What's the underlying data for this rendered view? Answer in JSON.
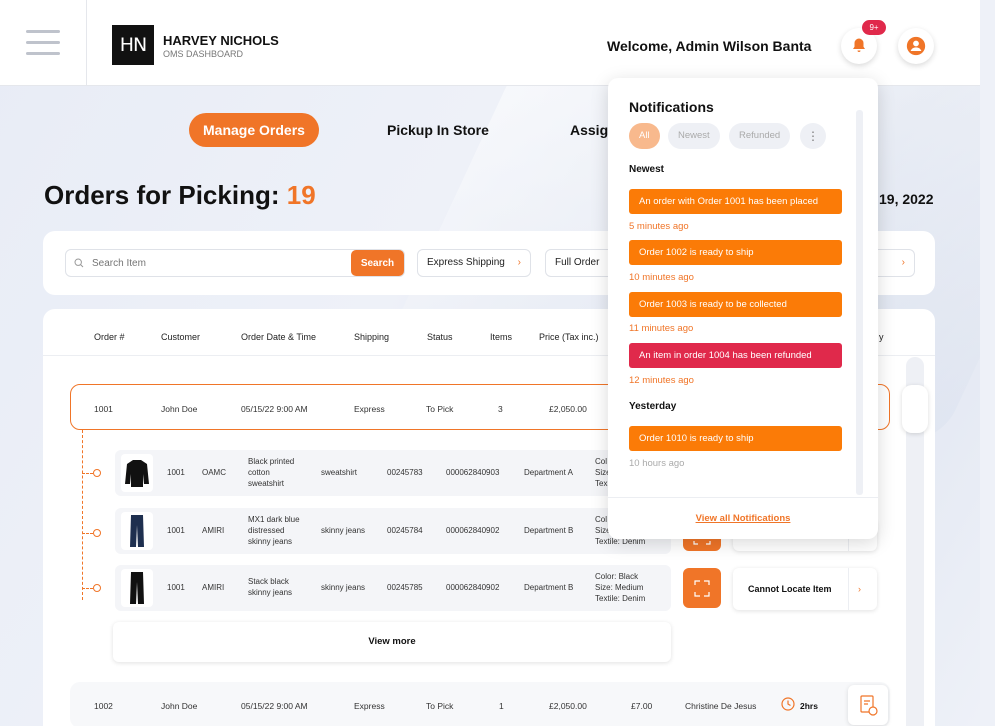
{
  "header": {
    "brand": "HARVEY NICHOLS",
    "brand_sub": "OMS DASHBOARD",
    "logo_text": "HN",
    "welcome": "Welcome, Admin Wilson Banta",
    "notif_badge": "9+"
  },
  "tabs": [
    {
      "label": "Manage Orders",
      "active": true
    },
    {
      "label": "Pickup In Store"
    },
    {
      "label": "Assig"
    }
  ],
  "page": {
    "title": "Orders for Picking: ",
    "count": "19",
    "date_fragment": "19, 2022"
  },
  "filters": {
    "search_placeholder": "Search Item",
    "search_button": "Search",
    "shipping": "Express Shipping",
    "status": "Full Order"
  },
  "table": {
    "columns": [
      "Order #",
      "Customer",
      "Order Date & Time",
      "Shipping",
      "Status",
      "Items",
      "Price (Tax inc.)",
      "y"
    ],
    "orders": [
      {
        "id": "1001",
        "customer": "John Doe",
        "date": "05/15/22  9:00 AM",
        "shipping": "Express",
        "status": "To Pick",
        "items": "3",
        "price": "£2,050.00"
      },
      {
        "id": "1002",
        "customer": "John Doe",
        "date": "05/15/22  9:00 AM",
        "shipping": "Express",
        "status": "To Pick",
        "items": "1",
        "price": "£2,050.00",
        "shipping_fee": "£7.00",
        "assignee": "Christine De Jesus",
        "time_left": "2hrs"
      }
    ],
    "items": [
      {
        "order": "1001",
        "brand": "OAMC",
        "name": [
          "Black printed",
          "cotton",
          "sweatshirt"
        ],
        "type": "sweatshirt",
        "sku": "00245783",
        "barcode": "000062840903",
        "department": "Department A",
        "attrs": [
          "Col",
          "Size",
          "Tex"
        ]
      },
      {
        "order": "1001",
        "brand": "AMIRI",
        "name": [
          "MX1 dark blue",
          "distressed",
          "skinny jeans"
        ],
        "type": "skinny jeans",
        "sku": "00245784",
        "barcode": "000062840902",
        "department": "Department B",
        "attrs": [
          "Col",
          "Size",
          "Textile: Denim"
        ]
      },
      {
        "order": "1001",
        "brand": "AMIRI",
        "name": [
          "Stack black",
          "skinny jeans"
        ],
        "type": "skinny jeans",
        "sku": "00245785",
        "barcode": "000062840902",
        "department": "Department B",
        "attrs": [
          "Color: Black",
          "Size: Medium",
          "Textile: Denim"
        ]
      }
    ],
    "cannot_locate": "Cannot Locate Item",
    "view_more": "View more"
  },
  "notifications": {
    "title": "Notifications",
    "filters": [
      "All",
      "Newest",
      "Refunded"
    ],
    "sections": [
      {
        "label": "Newest"
      },
      {
        "label": "Yesterday"
      }
    ],
    "items": [
      {
        "text": "An order with Order 1001 has been placed",
        "time": "5 minutes ago",
        "color": "#fb7b07"
      },
      {
        "text": "Order 1002 is ready to ship",
        "time": "10 minutes ago",
        "color": "#fb7b07"
      },
      {
        "text": "Order 1003 is ready to be collected",
        "time": "11 minutes ago",
        "color": "#fb7b07"
      },
      {
        "text": "An item in order 1004 has been refunded",
        "time": "12 minutes ago",
        "color": "#e0294b"
      },
      {
        "text": "Order 1010  is ready to ship",
        "time": "10 hours ago",
        "color": "#fb7b07"
      }
    ],
    "footer": "View all Notifications"
  },
  "colors": {
    "accent": "#f07528",
    "alert": "#e0294b"
  }
}
